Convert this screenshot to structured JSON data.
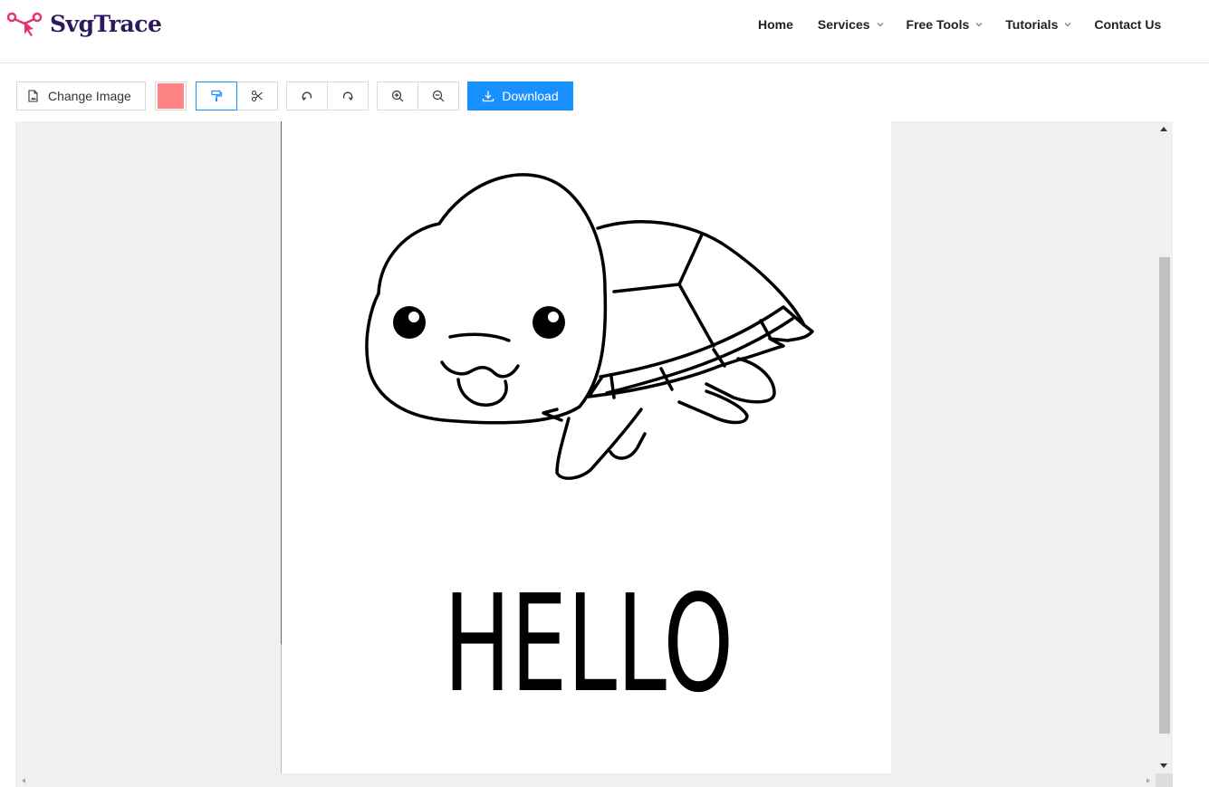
{
  "brand": {
    "name": "SvgTrace",
    "color": "#2d1a5c",
    "accent": "#e6336a",
    "icon": "scissors-cursor-logo-icon"
  },
  "nav": {
    "items": [
      {
        "label": "Home"
      },
      {
        "label": "Services"
      },
      {
        "label": "Free Tools"
      },
      {
        "label": "Tutorials"
      },
      {
        "label": "Contact Us"
      }
    ]
  },
  "toolbar": {
    "change_image_label": "Change Image",
    "download_label": "Download",
    "selected_color": "#ff8484",
    "primary_color": "#1890ff",
    "icons": {
      "change_image": "file-image-icon",
      "paint": "paint-roller-icon",
      "scissors": "scissors-icon",
      "undo": "undo-icon",
      "redo": "redo-icon",
      "zoom_in": "zoom-in-icon",
      "zoom_out": "zoom-out-icon",
      "download": "download-icon"
    }
  },
  "canvas": {
    "artwork_text": "HELLO"
  }
}
